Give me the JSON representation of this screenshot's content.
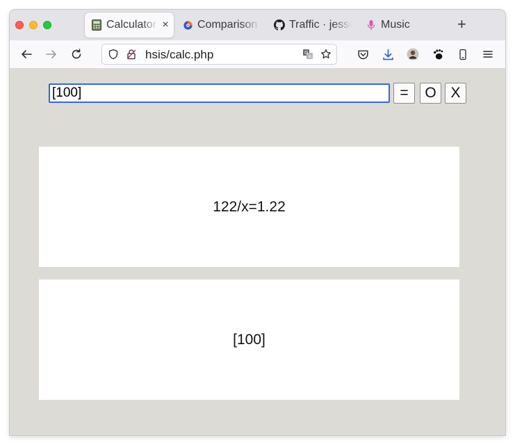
{
  "browser": {
    "tabs": [
      {
        "label": "Calculator",
        "icon": "calculator-icon",
        "active": true,
        "close": "×"
      },
      {
        "label": "Comparison",
        "icon": "firefox-logo-icon",
        "active": false
      },
      {
        "label": "Traffic · jesse",
        "icon": "github-icon",
        "active": false
      },
      {
        "label": "Music",
        "icon": "microphone-icon",
        "active": false
      }
    ],
    "new_tab": "+",
    "url": "hsis/calc.php"
  },
  "calculator": {
    "input_value": "[100]",
    "buttons": {
      "equals": "=",
      "o": "O",
      "x": "X"
    },
    "result_top": "122/x=1.22",
    "result_bottom": "[100]"
  },
  "colors": {
    "page_bg": "#dcdbd6",
    "input_focus_border": "#3c64d6",
    "panel_bg": "#ffffff"
  }
}
